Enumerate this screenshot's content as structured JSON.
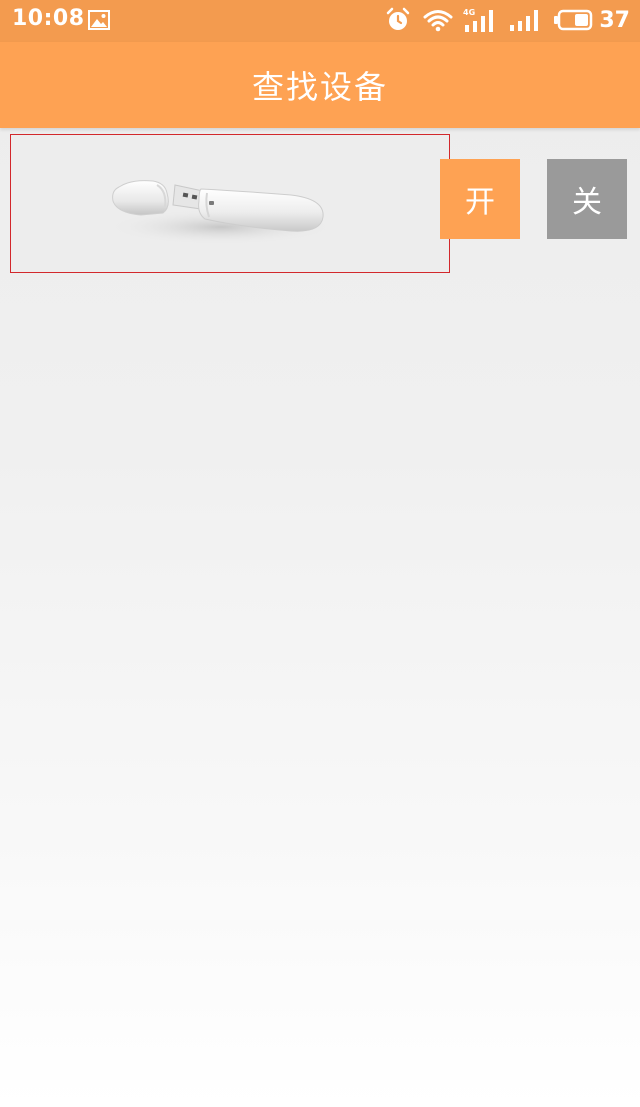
{
  "status_bar": {
    "time": "10:08",
    "battery_level": "37",
    "icons": [
      "image-icon",
      "alarm-icon",
      "wifi-icon",
      "signal-4g-icon",
      "signal-icon",
      "battery-icon"
    ]
  },
  "header": {
    "title": "查找设备"
  },
  "device": {
    "icon": "usb-drive-icon"
  },
  "controls": {
    "on_label": "开",
    "off_label": "关"
  },
  "colors": {
    "status_bar": "#f39b4f",
    "header": "#fea253",
    "on_button": "#fea253",
    "off_button": "#9a9a9a",
    "selection_border": "#d2282c"
  }
}
